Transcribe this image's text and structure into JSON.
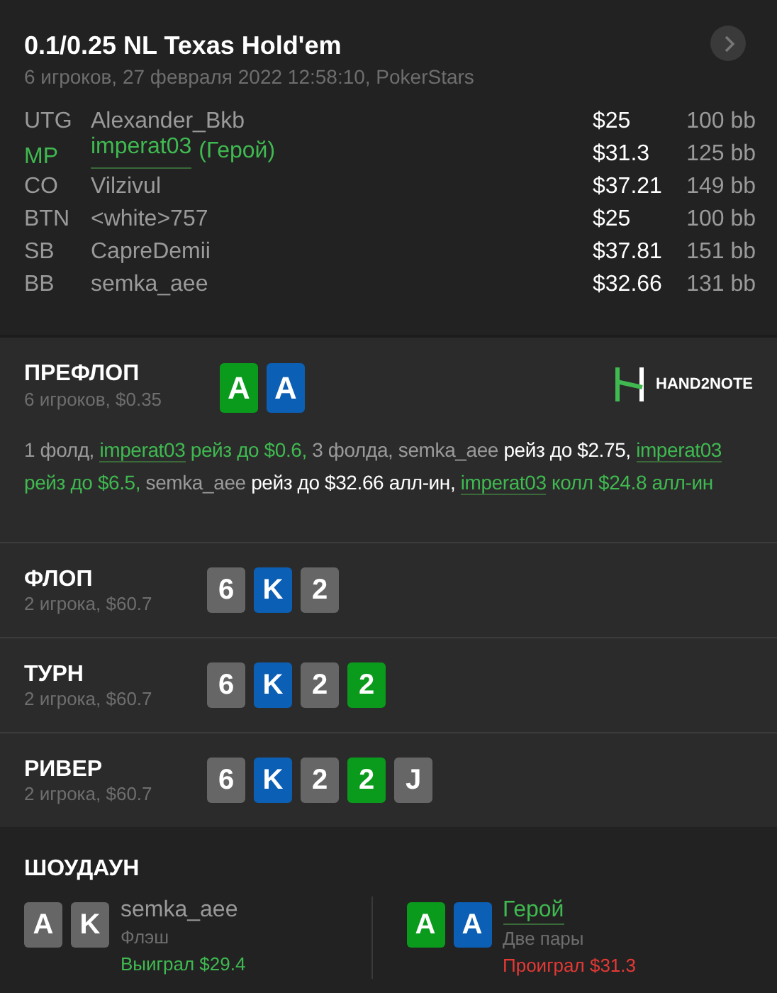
{
  "header": {
    "title": "0.1/0.25 NL Texas Hold'em",
    "subtitle": "6 игроков, 27 февраля 2022 12:58:10, PokerStars"
  },
  "players": [
    {
      "position": "UTG",
      "name": "Alexander_Bkb",
      "hero": false,
      "stack": "$25",
      "bb": "100 bb"
    },
    {
      "position": "MP",
      "name": "imperat03",
      "hero_tag": "(Герой)",
      "hero": true,
      "stack": "$31.3",
      "bb": "125 bb"
    },
    {
      "position": "CO",
      "name": "Vilzivul",
      "hero": false,
      "stack": "$37.21",
      "bb": "149 bb"
    },
    {
      "position": "BTN",
      "name": "<white>757",
      "hero": false,
      "stack": "$25",
      "bb": "100 bb"
    },
    {
      "position": "SB",
      "name": "CapreDemii",
      "hero": false,
      "stack": "$37.81",
      "bb": "151 bb"
    },
    {
      "position": "BB",
      "name": "semka_aee",
      "hero": false,
      "stack": "$32.66",
      "bb": "131 bb"
    }
  ],
  "preflop": {
    "title": "ПРЕФЛОП",
    "subtitle": "6 игроков, $0.35",
    "cards": [
      {
        "rank": "A",
        "color": "#0a9a1c"
      },
      {
        "rank": "A",
        "color": "#0b5fb4"
      }
    ],
    "logo": "HAND2NOTE",
    "actions": [
      {
        "kind": "plain",
        "text": "1 фолд, "
      },
      {
        "kind": "link",
        "text": "imperat03"
      },
      {
        "kind": "hero",
        "text": " рейз до $0.6,"
      },
      {
        "kind": "plain",
        "text": " 3 фолда, semka_aee"
      },
      {
        "kind": "strong",
        "text": " рейз до $2.75, "
      },
      {
        "kind": "link",
        "text": "imperat03"
      },
      {
        "kind": "hero",
        "text": " рейз до $6.5,"
      },
      {
        "kind": "plain",
        "text": " semka_aee"
      },
      {
        "kind": "strong",
        "text": " рейз до $32.66 алл-ин, "
      },
      {
        "kind": "link",
        "text": "imperat03"
      },
      {
        "kind": "hero",
        "text": " колл $24.8 алл-ин"
      }
    ]
  },
  "streets": [
    {
      "title": "ФЛОП",
      "subtitle": "2 игрока, $60.7",
      "cards": [
        {
          "rank": "6",
          "color": "#666666"
        },
        {
          "rank": "K",
          "color": "#0b5fb4"
        },
        {
          "rank": "2",
          "color": "#666666"
        }
      ]
    },
    {
      "title": "ТУРН",
      "subtitle": "2 игрока, $60.7",
      "cards": [
        {
          "rank": "6",
          "color": "#666666"
        },
        {
          "rank": "K",
          "color": "#0b5fb4"
        },
        {
          "rank": "2",
          "color": "#666666"
        },
        {
          "rank": "2",
          "color": "#0a9a1c"
        }
      ]
    },
    {
      "title": "РИВЕР",
      "subtitle": "2 игрока, $60.7",
      "cards": [
        {
          "rank": "6",
          "color": "#666666"
        },
        {
          "rank": "K",
          "color": "#0b5fb4"
        },
        {
          "rank": "2",
          "color": "#666666"
        },
        {
          "rank": "2",
          "color": "#0a9a1c"
        },
        {
          "rank": "J",
          "color": "#666666"
        }
      ]
    }
  ],
  "showdown": {
    "title": "ШОУДАУН",
    "hands": [
      {
        "name": "semka_aee",
        "hero": false,
        "hand": "Флэш",
        "result": "Выиграл $29.4",
        "won": true,
        "cards": [
          {
            "rank": "A",
            "color": "#666666"
          },
          {
            "rank": "K",
            "color": "#666666"
          }
        ]
      },
      {
        "name": "Герой",
        "hero": true,
        "hand": "Две пары",
        "result": "Проиграл $31.3",
        "won": false,
        "cards": [
          {
            "rank": "A",
            "color": "#0a9a1c"
          },
          {
            "rank": "A",
            "color": "#0b5fb4"
          }
        ]
      }
    ]
  }
}
